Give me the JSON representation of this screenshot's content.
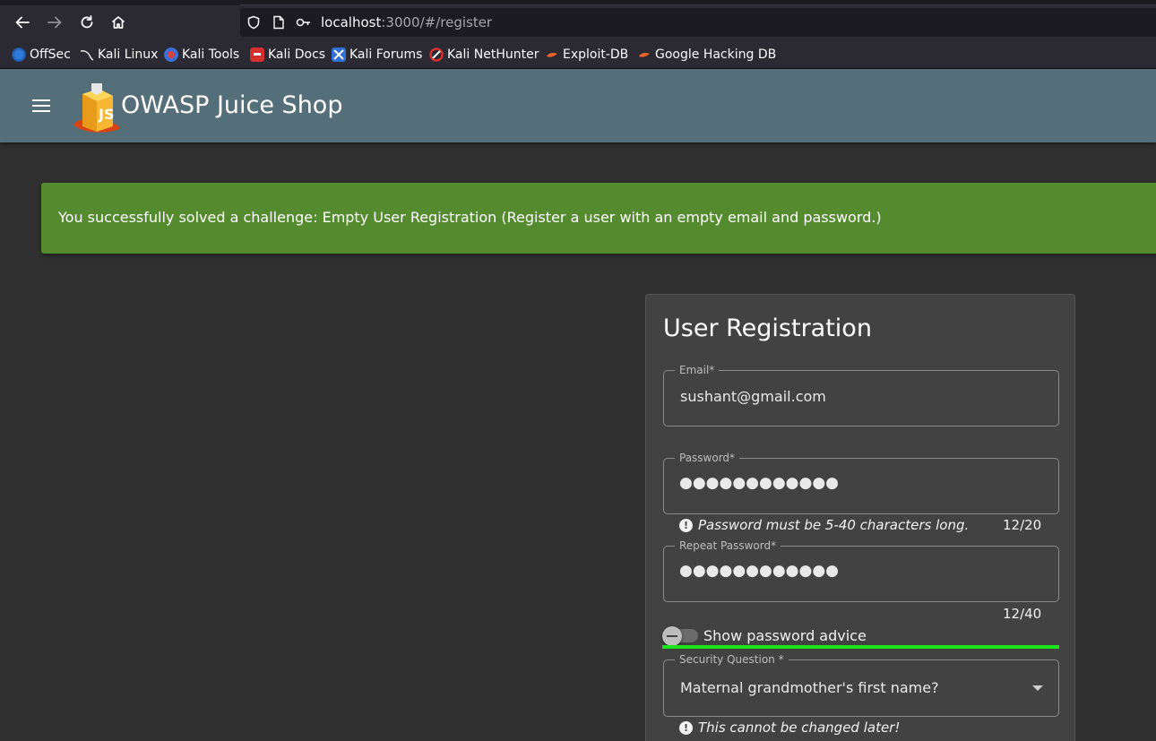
{
  "browser": {
    "url_host": "localhost",
    "url_rest": ":3000/#/register",
    "bookmarks": [
      {
        "label": "OffSec",
        "icon": "offsec-icon"
      },
      {
        "label": "Kali Linux",
        "icon": "kali-icon"
      },
      {
        "label": "Kali Tools",
        "icon": "kali-tools-icon"
      },
      {
        "label": "Kali Docs",
        "icon": "kali-docs-icon"
      },
      {
        "label": "Kali Forums",
        "icon": "kali-forums-icon"
      },
      {
        "label": "Kali NetHunter",
        "icon": "nethunter-icon"
      },
      {
        "label": "Exploit-DB",
        "icon": "exploitdb-icon"
      },
      {
        "label": "Google Hacking DB",
        "icon": "ghdb-icon"
      }
    ]
  },
  "app": {
    "title": "OWASP Juice Shop",
    "header_color": "#546e7a"
  },
  "snackbar": {
    "message": "You successfully solved a challenge: Empty User Registration (Register a user with an empty email and password.)",
    "color": "#558b2f"
  },
  "form": {
    "title": "User Registration",
    "email": {
      "label": "Email*",
      "value": "sushant@gmail.com"
    },
    "password": {
      "label": "Password*",
      "value": "●●●●●●●●●●●●",
      "error": "Password must be 5-40 characters long.",
      "counter": "12/20"
    },
    "repeat_password": {
      "label": "Repeat Password*",
      "value": "●●●●●●●●●●●●",
      "counter": "12/40"
    },
    "advice_toggle": {
      "label": "Show password advice",
      "checked": false
    },
    "security_question": {
      "label": "Security Question *",
      "value": "Maternal grandmother's first name?",
      "hint": "This cannot be changed later!"
    }
  }
}
